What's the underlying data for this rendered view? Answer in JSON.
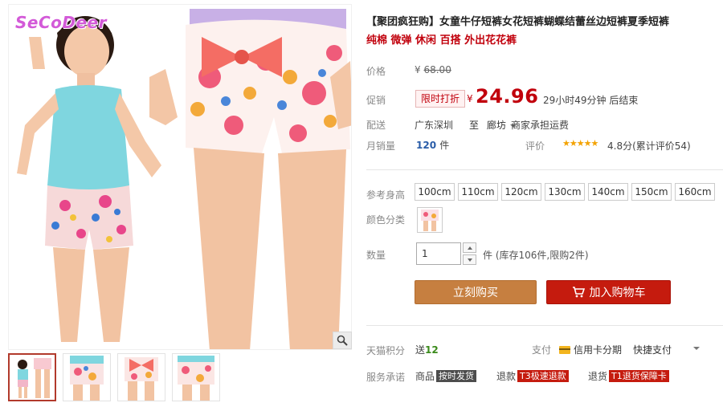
{
  "gallery": {
    "brand_logo": "SeCoDeer",
    "zoom_icon": "magnifier-icon",
    "thumbnail_count": 4
  },
  "product": {
    "title": "【聚团疯狂购】女童牛仔短裤女花短裤蝴蝶结蕾丝边短裤夏季短裤",
    "subtitle": "纯棉 微弹 休闲 百搭 外出花花裤"
  },
  "price": {
    "label": "价格",
    "currency": "¥",
    "original": "68.00"
  },
  "promo": {
    "label": "促销",
    "tag": "限时打折",
    "currency": "¥",
    "price": "24.96",
    "countdown": "29小时49分钟 后结束"
  },
  "shipping": {
    "label": "配送",
    "from": "广东深圳",
    "to_prefix": "至",
    "to": "廊坊",
    "fee": "商家承担运费"
  },
  "sales": {
    "label": "月销量",
    "count": "120",
    "unit": "件",
    "review_label": "评价",
    "stars": "★★★★★",
    "rating": "4.8分(累计评价54)"
  },
  "options": {
    "size_label": "参考身高",
    "sizes": [
      "100cm",
      "110cm",
      "120cm",
      "130cm",
      "140cm",
      "150cm",
      "160cm"
    ],
    "color_label": "颜色分类"
  },
  "quantity": {
    "label": "数量",
    "value": "1",
    "stock": "件 (库存106件,限购2件)"
  },
  "actions": {
    "buy_now": "立刻购买",
    "add_to_cart": "加入购物车"
  },
  "extras": {
    "points_label": "天猫积分",
    "points_prefix": "送",
    "points_value": "12",
    "pay_label": "支付",
    "pay_credit": "信用卡分期",
    "pay_quick": "快捷支付",
    "service_label": "服务承诺",
    "svc_goods_label": "商品",
    "svc_goods_badge": "按时发货",
    "svc_return_label": "退款",
    "svc_return_badge": "T3极速退款",
    "svc_return2_label": "退货",
    "svc_return2_badge": "T1退货保障卡"
  },
  "colors": {
    "promo_red": "#c1000c",
    "buy_button": "#c67f40",
    "cart_button": "#c51b0e",
    "star": "#f3a200",
    "link_blue": "#2a5da8"
  }
}
